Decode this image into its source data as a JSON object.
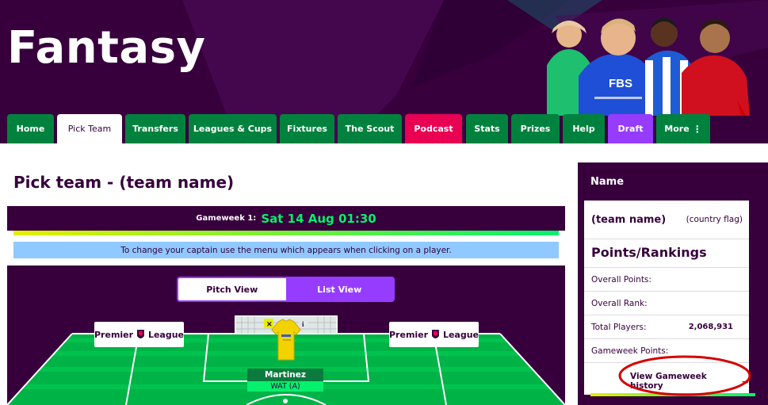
{
  "header": {
    "brand": "Fantasy",
    "sponsor_shirt_text": "FBS"
  },
  "nav": {
    "tabs": [
      {
        "label": "Home"
      },
      {
        "label": "Pick Team"
      },
      {
        "label": "Transfers"
      },
      {
        "label": "Leagues & Cups"
      },
      {
        "label": "Fixtures"
      },
      {
        "label": "The Scout"
      },
      {
        "label": "Podcast"
      },
      {
        "label": "Stats"
      },
      {
        "label": "Prizes"
      },
      {
        "label": "Help"
      },
      {
        "label": "Draft"
      },
      {
        "label": "More"
      }
    ],
    "active_index": 1
  },
  "main": {
    "title": "Pick team - (team name)",
    "gameweek_label": "Gameweek 1:",
    "gameweek_deadline": "Sat 14 Aug 01:30",
    "captain_info": "To change your captain use the menu which appears when clicking on a player.",
    "views": {
      "pitch": "Pitch View",
      "list": "List View",
      "selected": "Pitch View"
    },
    "board_text_left": "Premier",
    "board_text_right": "League",
    "player": {
      "name": "Martinez",
      "fixture": "WAT (A)"
    }
  },
  "side": {
    "heading": "Name",
    "team_name": "(team name)",
    "country": "(country flag)",
    "points_title": "Points/Rankings",
    "rows": [
      {
        "label": "Overall Points:",
        "value": ""
      },
      {
        "label": "Overall Rank:",
        "value": ""
      },
      {
        "label": "Total Players:",
        "value": "2,068,931"
      },
      {
        "label": "Gameweek Points:",
        "value": ""
      }
    ],
    "history_link": "View Gameweek history",
    "history_arrow": "→"
  },
  "colors": {
    "purple": "#37003c",
    "green_tab": "#00823e",
    "pink": "#e90052",
    "violet": "#963cff",
    "neon_green": "#05f06c",
    "pitch": "#00c34d",
    "annotation_red": "#d40000"
  },
  "icons": {
    "more": "vertical-dots-icon",
    "arrow": "arrow-right-icon",
    "captain": "captain-badge-icon",
    "info": "info-icon"
  }
}
